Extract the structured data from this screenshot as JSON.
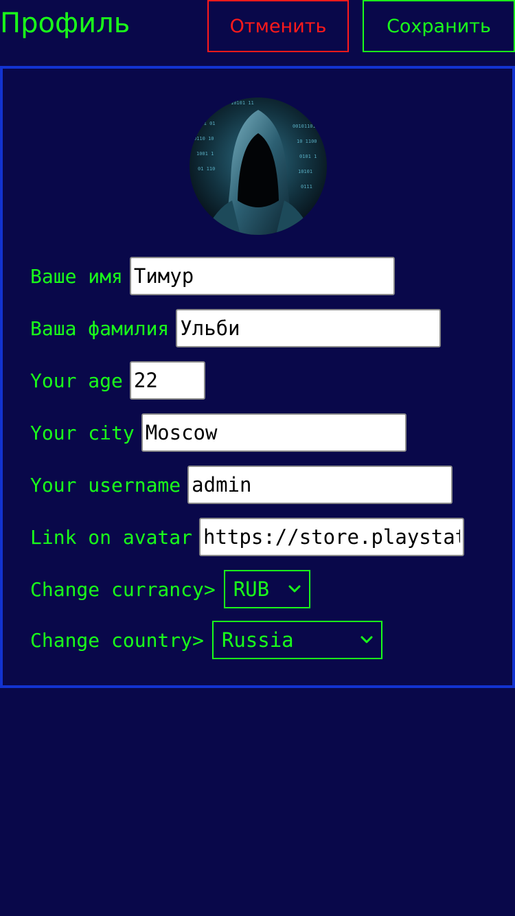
{
  "header": {
    "title": "Профиль",
    "cancel_label": "Отменить",
    "save_label": "Сохранить"
  },
  "avatar": {
    "alt": "hooded figure avatar"
  },
  "form": {
    "first_name": {
      "label": "Ваше имя",
      "value": "Тимур"
    },
    "last_name": {
      "label": "Ваша фамилия",
      "value": "Ульби"
    },
    "age": {
      "label": "Your age",
      "value": "22"
    },
    "city": {
      "label": "Your city",
      "value": "Moscow"
    },
    "username": {
      "label": "Your username",
      "value": "admin"
    },
    "avatar_link": {
      "label": "Link on avatar",
      "value": "https://store.playstat"
    },
    "currency": {
      "label": "Change currancy>",
      "value": "RUB"
    },
    "country": {
      "label": "Change country>",
      "value": "Russia"
    }
  },
  "icons": [
    "chevron-down-icon"
  ],
  "colors": {
    "background": "#09084a",
    "accent_green": "#1aff1a",
    "cancel_red": "#ff1a1a",
    "card_border": "#1233d0"
  }
}
